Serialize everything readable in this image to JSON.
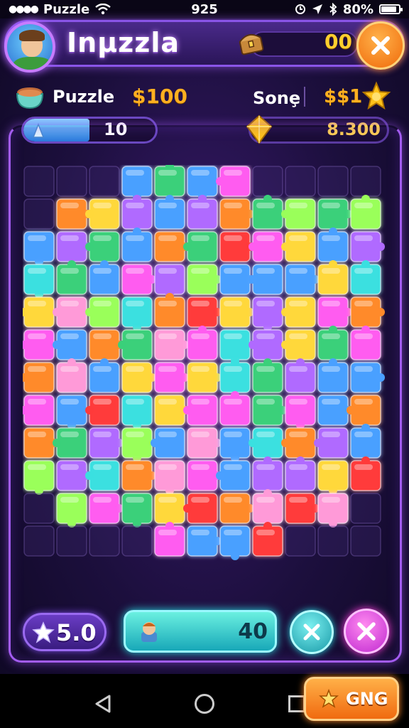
{
  "status_bar": {
    "carrier": "Puzzle",
    "time": "925",
    "battery": "80%"
  },
  "header": {
    "title": "Inμzzla",
    "score": "00"
  },
  "resources": {
    "left_label": "Puzzle",
    "left_amount": "$100",
    "right_label": "Sonȩ",
    "right_amount": "$$1"
  },
  "progress": {
    "value": "10",
    "fill_fraction": 0.5
  },
  "gems": {
    "value": "8.300"
  },
  "bottom": {
    "star_score": "5.0",
    "hint_count": "40",
    "bonus_label": "GNG"
  },
  "colors": {
    "accent_purple": "#a35cf0",
    "gold": "#ffb020",
    "orange_button": "#f06a0a",
    "teal_button": "#18a8b8",
    "pink_button": "#c02ad0"
  },
  "icons": {
    "carrier_signal": "signal-dots-icon",
    "wifi": "wifi-icon",
    "alarm": "alarm-icon",
    "location": "location-icon",
    "bluetooth": "bluetooth-icon",
    "battery": "battery-icon",
    "chest": "treasure-chest-icon",
    "close": "close-icon",
    "pot": "cauldron-icon",
    "badge": "gold-star-badge-icon",
    "progress": "crystal-icon",
    "gem": "gold-gem-icon",
    "star": "star-icon",
    "hint_avatar": "character-icon"
  }
}
